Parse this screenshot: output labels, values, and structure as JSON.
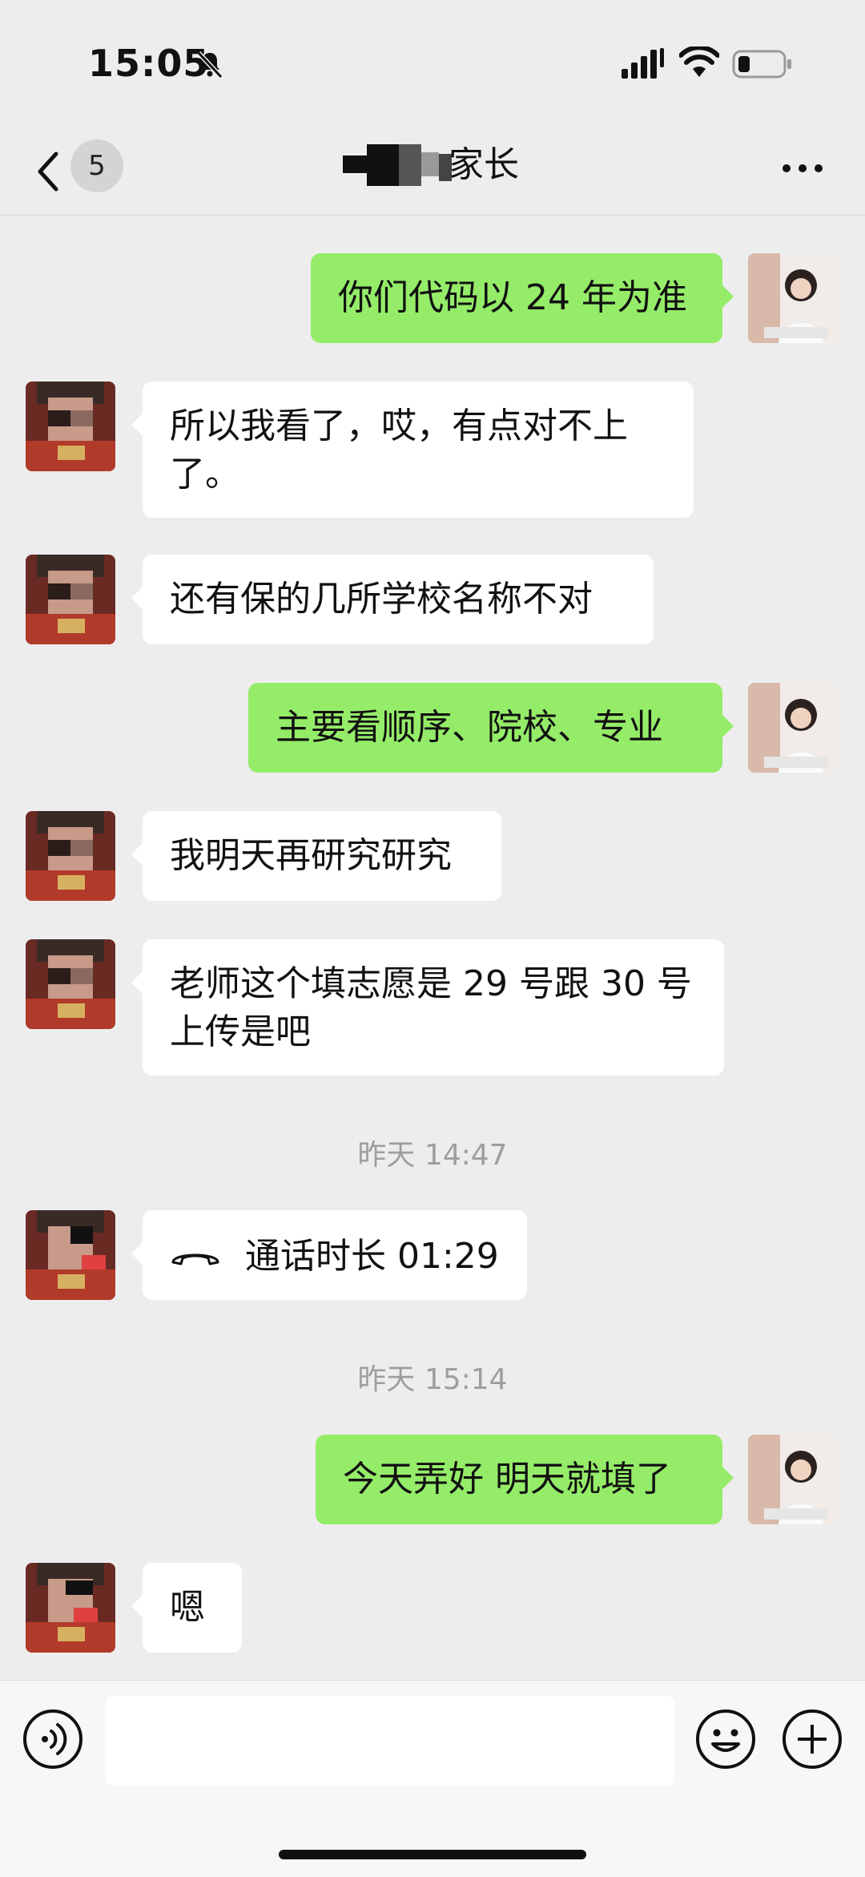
{
  "status_bar": {
    "time": "15:05",
    "muted": true
  },
  "header": {
    "unread_count": "5",
    "title": "家长",
    "title_obscured": true
  },
  "messages": [
    {
      "from": "me",
      "text": "你们代码以 24 年为准"
    },
    {
      "from": "them",
      "text": "所以我看了，哎，有点对不上了。"
    },
    {
      "from": "them",
      "text": "还有保的几所学校名称不对"
    },
    {
      "from": "me",
      "text": "主要看顺序、院校、专业"
    },
    {
      "from": "them",
      "text": "我明天再研究研究"
    },
    {
      "from": "them",
      "text": "老师这个填志愿是 29 号跟 30 号上传是吧"
    },
    {
      "timestamp": "昨天 14:47"
    },
    {
      "from": "them",
      "call": true,
      "text": "通话时长 01:29"
    },
    {
      "timestamp": "昨天 15:14"
    },
    {
      "from": "me",
      "text": "今天弄好 明天就填了"
    },
    {
      "from": "them",
      "text": "嗯"
    }
  ],
  "input_bar": {
    "icons": [
      "voice-icon",
      "emoji-icon",
      "plus-icon"
    ],
    "text_value": ""
  },
  "colors": {
    "outgoing_bubble": "#95ec69",
    "incoming_bubble": "#ffffff",
    "background": "#ededed"
  }
}
